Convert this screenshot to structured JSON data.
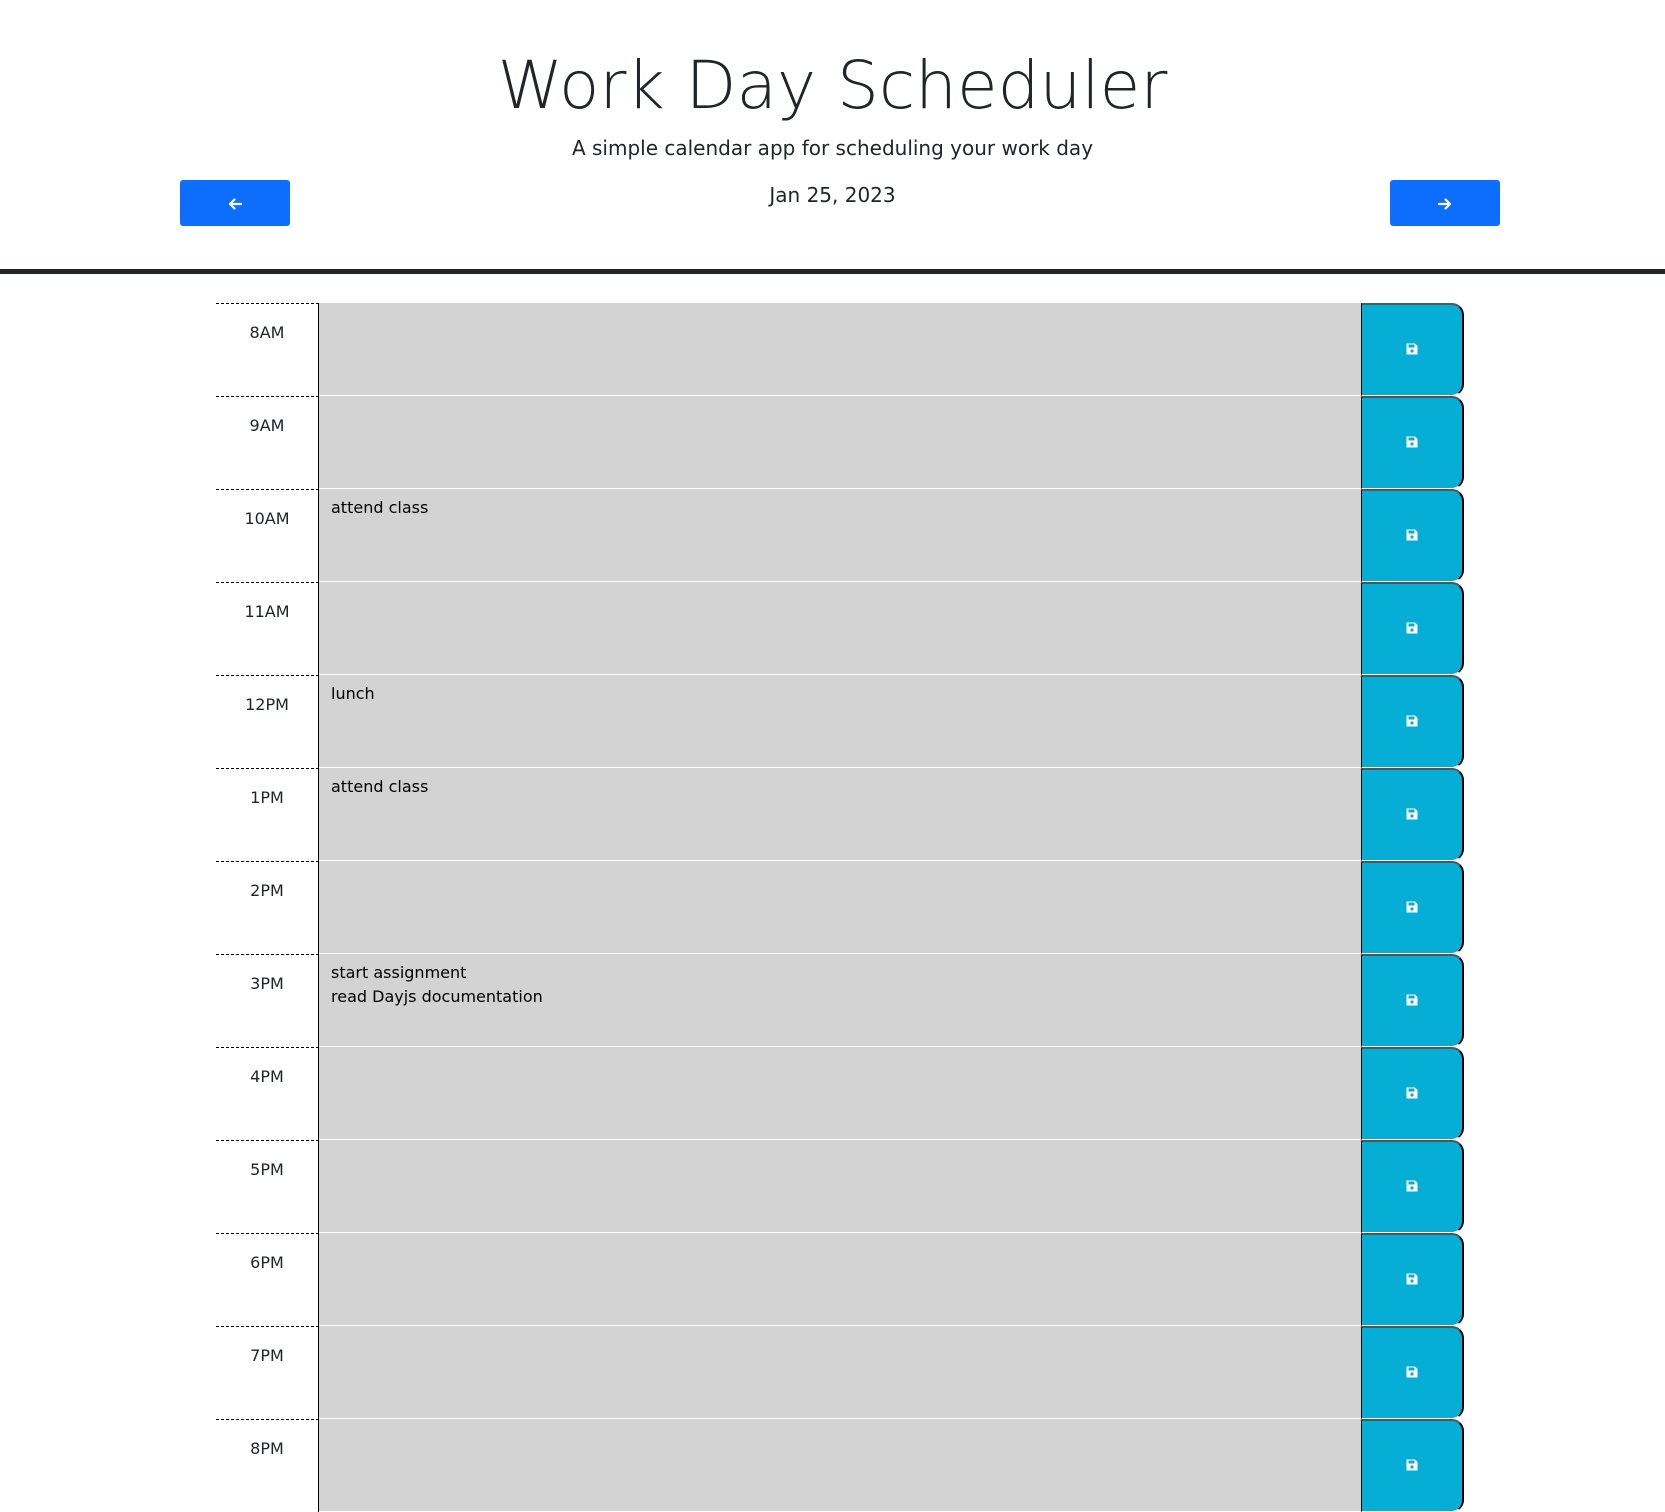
{
  "header": {
    "title": "Work Day Scheduler",
    "subtitle": "A simple calendar app for scheduling your work day",
    "date": "Jan 25, 2023",
    "prev_icon": "arrow-left-icon",
    "next_icon": "arrow-right-icon"
  },
  "colors": {
    "nav_button": "#0d6efd",
    "save_button": "#06aed5",
    "row_background": "#d3d3d3"
  },
  "rows": [
    {
      "hour": "8AM",
      "text": ""
    },
    {
      "hour": "9AM",
      "text": ""
    },
    {
      "hour": "10AM",
      "text": "attend class"
    },
    {
      "hour": "11AM",
      "text": ""
    },
    {
      "hour": "12PM",
      "text": "lunch"
    },
    {
      "hour": "1PM",
      "text": "attend class"
    },
    {
      "hour": "2PM",
      "text": ""
    },
    {
      "hour": "3PM",
      "text": "start assignment\nread Dayjs documentation"
    },
    {
      "hour": "4PM",
      "text": ""
    },
    {
      "hour": "5PM",
      "text": ""
    },
    {
      "hour": "6PM",
      "text": ""
    },
    {
      "hour": "7PM",
      "text": ""
    },
    {
      "hour": "8PM",
      "text": ""
    }
  ],
  "save_icon": "save-icon"
}
